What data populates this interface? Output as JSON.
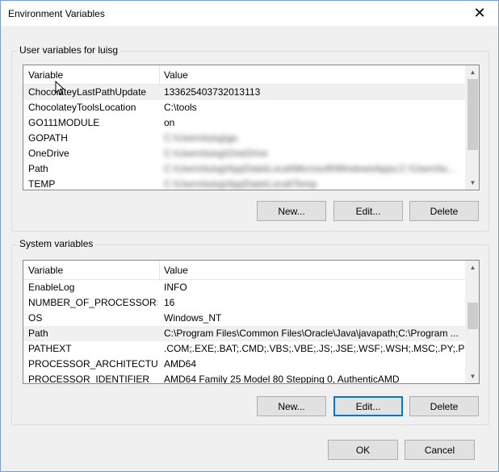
{
  "window": {
    "title": "Environment Variables",
    "close_glyph": "✕"
  },
  "user_group": {
    "label": "User variables for luisg",
    "columns": [
      "Variable",
      "Value"
    ],
    "rows": [
      {
        "variable": "ChocolateyLastPathUpdate",
        "value": "133625403732013113",
        "blurred": false
      },
      {
        "variable": "ChocolateyToolsLocation",
        "value": "C:\\tools",
        "blurred": false
      },
      {
        "variable": "GO111MODULE",
        "value": "on",
        "blurred": false
      },
      {
        "variable": "GOPATH",
        "value": "C:\\Users\\luisg\\go",
        "blurred": true
      },
      {
        "variable": "OneDrive",
        "value": "C:\\Users\\luisg\\OneDrive",
        "blurred": true
      },
      {
        "variable": "Path",
        "value": "C:\\Users\\luisg\\AppData\\Local\\Microsoft\\WindowsApps;C:\\Users\\lu...",
        "blurred": true
      },
      {
        "variable": "TEMP",
        "value": "C:\\Users\\luisg\\AppData\\Local\\Temp",
        "blurred": true
      }
    ],
    "buttons": {
      "new": "New...",
      "edit": "Edit...",
      "delete": "Delete"
    }
  },
  "system_group": {
    "label": "System variables",
    "columns": [
      "Variable",
      "Value"
    ],
    "rows": [
      {
        "variable": "EnableLog",
        "value": "INFO",
        "selected": false
      },
      {
        "variable": "NUMBER_OF_PROCESSORS",
        "value": "16",
        "selected": false
      },
      {
        "variable": "OS",
        "value": "Windows_NT",
        "selected": false
      },
      {
        "variable": "Path",
        "value": "C:\\Program Files\\Common Files\\Oracle\\Java\\javapath;C:\\Program ...",
        "selected": true
      },
      {
        "variable": "PATHEXT",
        "value": ".COM;.EXE;.BAT;.CMD;.VBS;.VBE;.JS;.JSE;.WSF;.WSH;.MSC;.PY;.PYW",
        "selected": false
      },
      {
        "variable": "PROCESSOR_ARCHITECTURE",
        "value": "AMD64",
        "selected": false
      },
      {
        "variable": "PROCESSOR_IDENTIFIER",
        "value": "AMD64 Family 25 Model 80 Stepping 0, AuthenticAMD",
        "selected": false
      }
    ],
    "buttons": {
      "new": "New...",
      "edit": "Edit...",
      "delete": "Delete"
    }
  },
  "footer": {
    "ok": "OK",
    "cancel": "Cancel"
  },
  "icons": {
    "close": "close-icon",
    "scroll_up": "chevron-up-icon",
    "scroll_down": "chevron-down-icon",
    "cursor": "mouse-pointer-icon"
  },
  "colors": {
    "accent": "#0078d7",
    "selection": "#f0f0f0",
    "dialog_bg": "#f0f0f0"
  }
}
